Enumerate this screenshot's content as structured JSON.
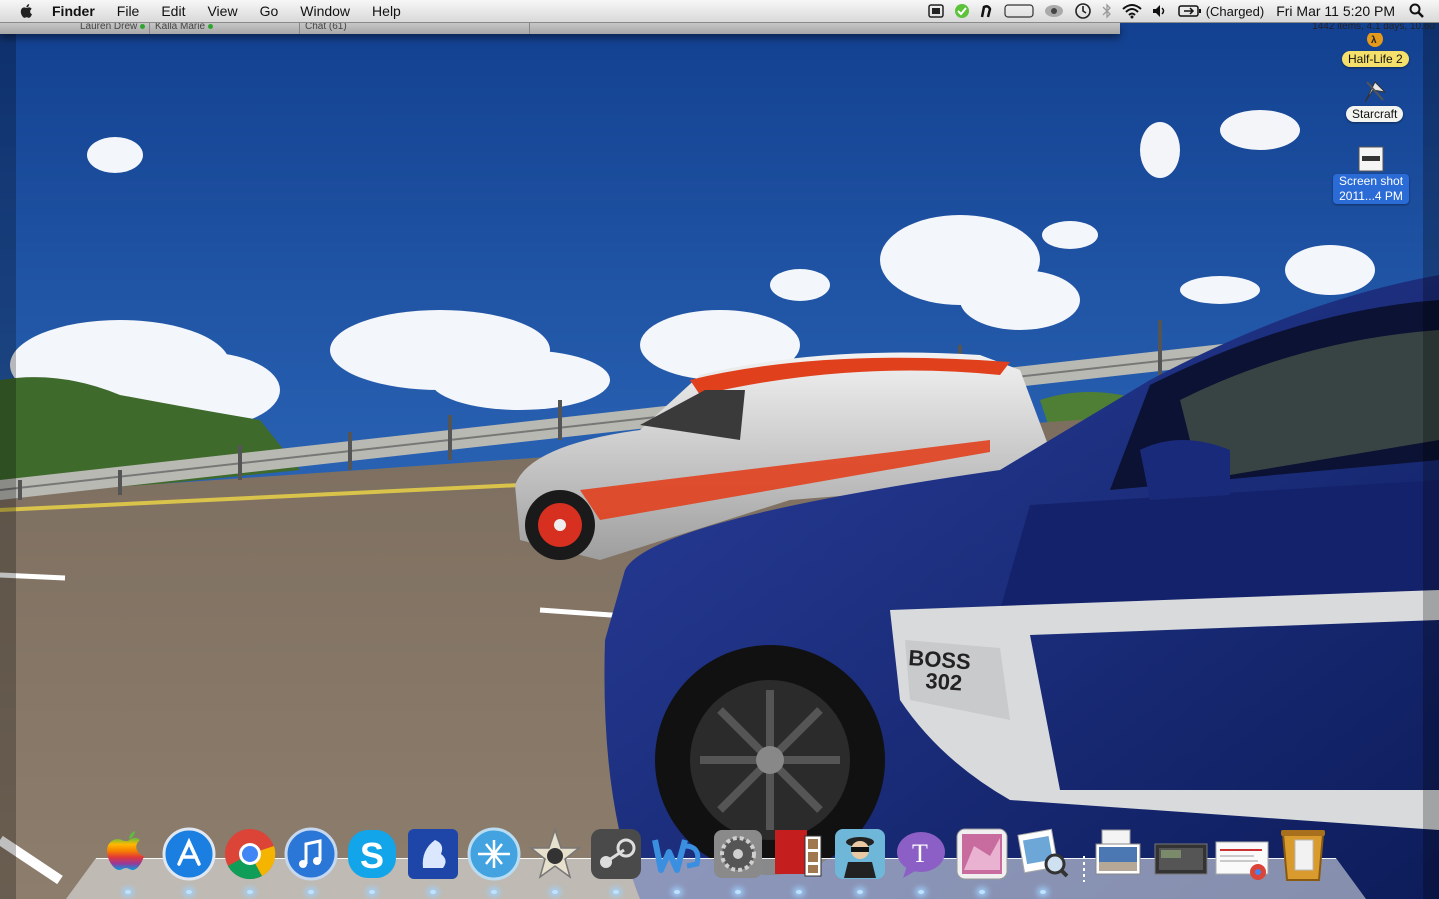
{
  "menubar": {
    "app_name": "Finder",
    "menus": [
      "File",
      "Edit",
      "View",
      "Go",
      "Window",
      "Help"
    ],
    "battery_status": "(Charged)",
    "clock": "Fri Mar 11  5:20 PM"
  },
  "background_windows": {
    "tabs": [
      "Lauren Drew",
      "Kalla Marie",
      "Chat (61)"
    ],
    "status_text": "1442 items, 4.1 days, 10.60"
  },
  "desktop_icons": [
    {
      "label": "Half-Life 2",
      "icon": "half-life-2-icon"
    },
    {
      "label": "Starcraft",
      "icon": "starcraft-icon"
    },
    {
      "label_line1": "Screen shot",
      "label_line2": "2011...4 PM",
      "icon": "screenshot-file-icon",
      "selected": true
    }
  ],
  "wallpaper": {
    "car_badge_line1": "BOSS",
    "car_badge_line2": "302"
  },
  "dock": {
    "apps": [
      "finder-apple-icon",
      "app-store-icon",
      "chrome-icon",
      "itunes-icon",
      "skype-icon",
      "vuze-icon",
      "transmission-icon",
      "imovie-icon",
      "steam-icon",
      "word-icon",
      "system-preferences-icon",
      "photo-booth-icon",
      "spy-app-icon",
      "textfree-icon",
      "game-app-icon",
      "preview-icon"
    ],
    "stacks": [
      "documents-stack-icon",
      "downloads-stack-icon",
      "chrome-stack-icon",
      "trash-icon"
    ],
    "textfree_letter": "T"
  }
}
